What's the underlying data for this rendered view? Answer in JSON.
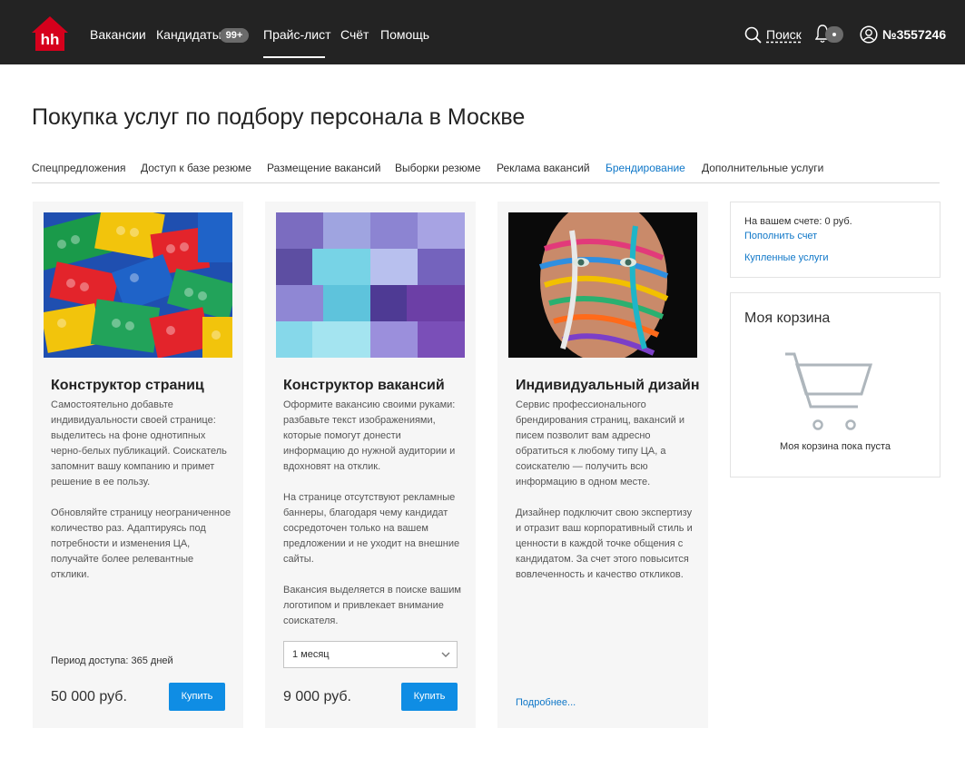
{
  "header": {
    "logo_text": "hh",
    "nav": [
      {
        "label": "Вакансии"
      },
      {
        "label": "Кандидаты"
      },
      {
        "label": "Прайс-лист"
      },
      {
        "label": "Счёт"
      },
      {
        "label": "Помощь"
      }
    ],
    "candidates_badge": "99+",
    "active_nav": "Прайс-лист",
    "search_label": "Поиск",
    "account_label": "№3557246"
  },
  "page_title": "Покупка услуг по подбору персонала в Москве",
  "tabs": [
    {
      "label": "Спецпредложения"
    },
    {
      "label": "Доступ к базе резюме"
    },
    {
      "label": "Размещение вакансий"
    },
    {
      "label": "Выборки резюме"
    },
    {
      "label": "Реклама вакансий"
    },
    {
      "label": "Брендирование"
    },
    {
      "label": "Дополнительные услуги"
    }
  ],
  "active_tab": "Брендирование",
  "cards": [
    {
      "title": "Конструктор страниц",
      "paragraphs": [
        "Самостоятельно добавьте индивидуальности своей странице: выделитесь на фоне однотипных черно-белых публикаций. Соискатель запомнит вашу компанию и примет решение в ее пользу.",
        "Обновляйте страницу неограниченное количество раз. Адаптируясь под потребности и изменения ЦА, получайте более релевантные отклики."
      ],
      "period": "Период доступа: 365 дней",
      "price": "50 000 руб.",
      "buy_label": "Купить"
    },
    {
      "title": "Конструктор вакансий",
      "paragraphs": [
        "Оформите вакансию своими руками: разбавьте текст изображениями, которые помогут донести информацию до нужной аудитории и вдохновят на отклик.",
        "На странице отсутствуют рекламные баннеры, благодаря чему кандидат сосредоточен только на вашем предложении и не уходит на внешние сайты.",
        "Вакансия выделяется в поиске вашим логотипом и привлекает внимание соискателя."
      ],
      "select_value": "1 месяц",
      "price": "9 000 руб.",
      "buy_label": "Купить"
    },
    {
      "title": "Индивидуальный дизайн",
      "paragraphs": [
        "Сервис профессионального брендирования страниц, вакансий и писем позволит вам адресно обратиться к любому типу ЦА, а соискателю — получить всю информацию в одном месте.",
        "Дизайнер подключит свою экспертизу и отразит ваш корпоративный стиль и ценности в каждой точке общения с кандидатом. За счет этого повысится вовлеченность и качество откликов."
      ],
      "more_label": "Подробнее..."
    }
  ],
  "sidebar": {
    "balance": "На вашем счете: 0 руб.",
    "topup_link": "Пополнить счет",
    "purchased_link": "Купленные услуги",
    "cart_title": "Моя корзина",
    "cart_empty": "Моя корзина пока пуста"
  },
  "colors": {
    "header_bg": "#232323",
    "accent_link": "#0f77c8",
    "button_bg": "#0f8de4",
    "logo_red": "#d6001c",
    "card_bg": "#f6f6f6"
  },
  "icons": {
    "search": "search-icon",
    "notifications": "bell-icon",
    "account": "user-icon",
    "cart": "cart-icon",
    "select_arrow": "chevron-down-icon"
  }
}
